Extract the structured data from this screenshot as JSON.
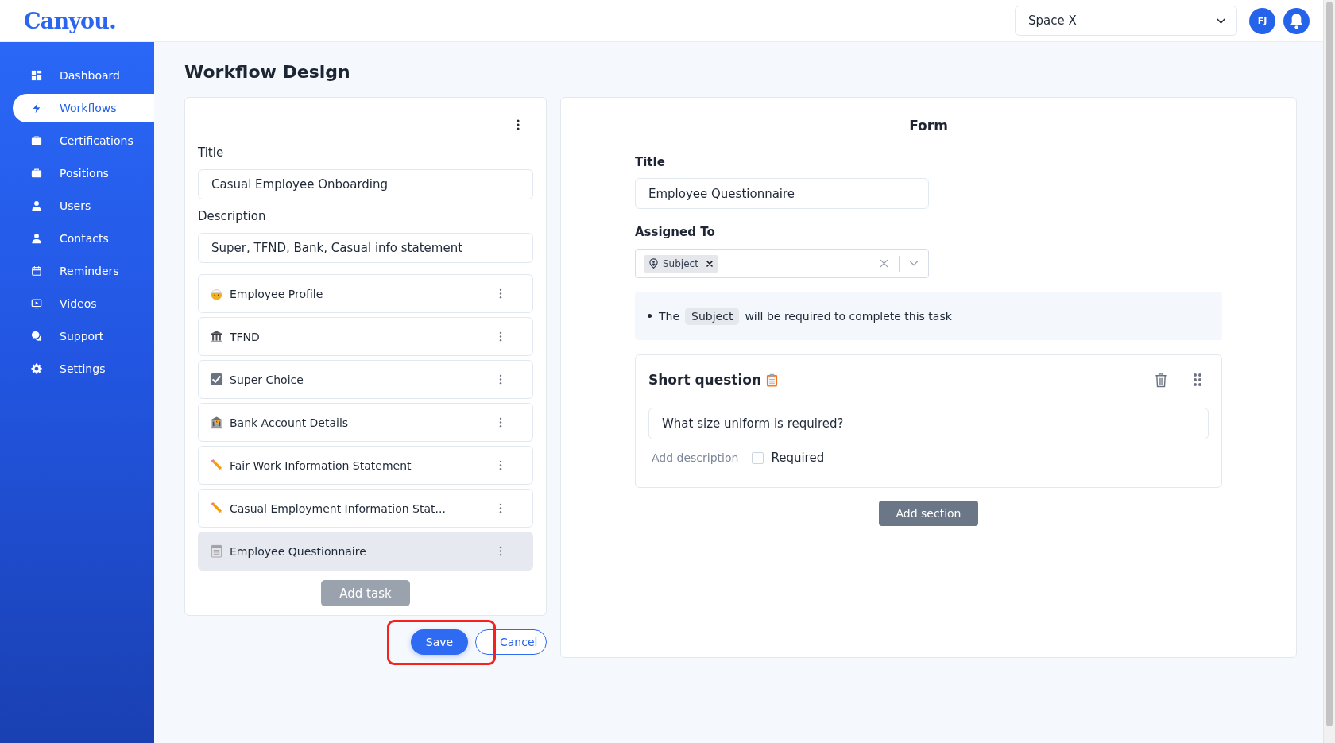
{
  "header": {
    "logo": "Canyou.",
    "workspace_select": {
      "value": "Space X"
    },
    "avatar": {
      "initials": "FJ"
    }
  },
  "sidebar": {
    "items": [
      {
        "label": "Dashboard",
        "selected": false
      },
      {
        "label": "Workflows",
        "selected": true
      },
      {
        "label": "Certifications",
        "selected": false
      },
      {
        "label": "Positions",
        "selected": false
      },
      {
        "label": "Users",
        "selected": false
      },
      {
        "label": "Contacts",
        "selected": false
      },
      {
        "label": "Reminders",
        "selected": false
      },
      {
        "label": "Videos",
        "selected": false
      },
      {
        "label": "Support",
        "selected": false
      },
      {
        "label": "Settings",
        "selected": false
      }
    ]
  },
  "page_title": "Workflow Design",
  "workflow_panel": {
    "title_field": {
      "label": "Title",
      "value": "Casual Employee Onboarding"
    },
    "description_field": {
      "label": "Description",
      "value": "Super, TFND, Bank, Casual info statement"
    },
    "tasks": [
      {
        "label": "Employee Profile",
        "selected": false
      },
      {
        "label": "TFND",
        "selected": false
      },
      {
        "label": "Super Choice",
        "selected": false
      },
      {
        "label": "Bank Account Details",
        "selected": false
      },
      {
        "label": "Fair Work Information Statement",
        "selected": false
      },
      {
        "label": "Casual Employment Information Stat...",
        "selected": false
      },
      {
        "label": "Employee Questionnaire",
        "selected": true
      }
    ],
    "add_task_button": "Add task"
  },
  "actions": {
    "save": {
      "label": "Save",
      "highlighted": true
    },
    "cancel": {
      "label": "Cancel"
    }
  },
  "form_panel": {
    "heading": "Form",
    "title_field": {
      "label": "Title",
      "value": "Employee Questionnaire"
    },
    "assigned_to": {
      "label": "Assigned To",
      "tags": [
        {
          "label": "Subject"
        }
      ]
    },
    "note": {
      "parts": [
        {
          "kind": "text",
          "text": "The"
        },
        {
          "kind": "tag",
          "text": "Subject"
        },
        {
          "kind": "text",
          "text": "will be required to complete this task"
        }
      ]
    },
    "question": {
      "heading": "Short question",
      "value": "What size uniform is required?",
      "add_description": "Add description",
      "required": {
        "label": "Required",
        "checked": false
      }
    },
    "add_section_button": "Add section"
  }
}
